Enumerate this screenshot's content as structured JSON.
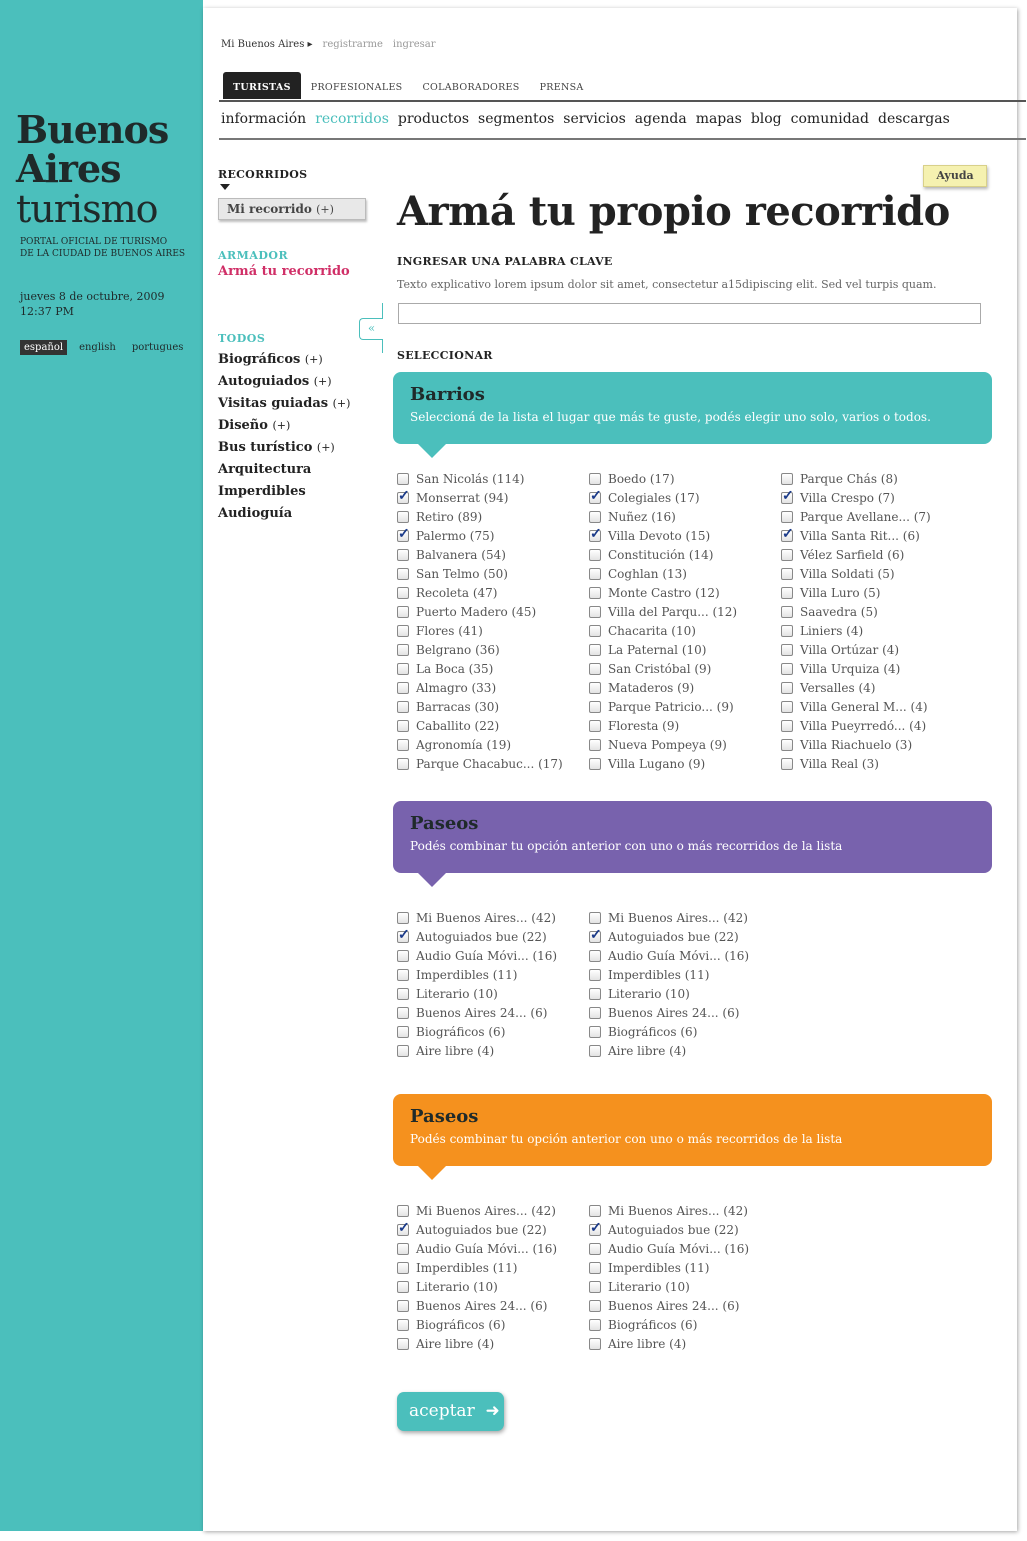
{
  "brand": {
    "line1": "Buenos",
    "line2": "Aires",
    "line3": "turismo",
    "tagline1": "PORTAL OFICIAL DE TURISMO",
    "tagline2": "DE LA CIUDAD DE BUENOS AIRES"
  },
  "datetime": {
    "date": "jueves 8 de octubre, 2009",
    "time": "12:37 PM"
  },
  "languages": [
    "español",
    "english",
    "portugues"
  ],
  "topbar": {
    "account": "Mi Buenos Aires ▸",
    "register": "registrarme",
    "login": "ingresar"
  },
  "tabs": [
    "TURISTAS",
    "PROFESIONALES",
    "COLABORADORES",
    "PRENSA"
  ],
  "nav": [
    "información",
    "recorridos",
    "productos",
    "segmentos",
    "servicios",
    "agenda",
    "mapas",
    "blog",
    "comunidad",
    "descargas"
  ],
  "sidebar": {
    "title": "RECORRIDOS",
    "mi_recorrido": "Mi recorrido",
    "mi_recorrido_plus": "(+)",
    "armador": "ARMADOR",
    "arma_link": "Armá tu recorrido",
    "todos": "TODOS",
    "categories": [
      {
        "label": "Biográficos",
        "plus": "(+)"
      },
      {
        "label": "Autoguiados",
        "plus": "(+)"
      },
      {
        "label": "Visitas guiadas",
        "plus": "(+)"
      },
      {
        "label": "Diseño",
        "plus": "(+)"
      },
      {
        "label": "Bus turístico",
        "plus": "(+)"
      },
      {
        "label": "Arquitectura",
        "plus": ""
      },
      {
        "label": "Imperdibles",
        "plus": ""
      },
      {
        "label": "Audioguía",
        "plus": ""
      }
    ],
    "collapse_glyph": "«"
  },
  "help_label": "Ayuda",
  "page_title": "Armá tu propio recorrido",
  "keyword": {
    "label": "INGRESAR UNA PALABRA CLAVE",
    "help": "Texto explicativo lorem ipsum dolor sit amet, consectetur a15dipiscing elit. Sed vel turpis quam.",
    "value": ""
  },
  "select_label": "SELECCIONAR",
  "barrios": {
    "title": "Barrios",
    "desc": "Seleccioná de la lista el lugar que más te guste, podés elegir uno solo, varios o todos.",
    "columns": [
      [
        {
          "label": "San Nicolás (114)",
          "checked": false
        },
        {
          "label": "Monserrat (94)",
          "checked": true
        },
        {
          "label": "Retiro (89)",
          "checked": false
        },
        {
          "label": "Palermo (75)",
          "checked": true
        },
        {
          "label": "Balvanera (54)",
          "checked": false
        },
        {
          "label": "San Telmo (50)",
          "checked": false
        },
        {
          "label": "Recoleta (47)",
          "checked": false
        },
        {
          "label": "Puerto Madero (45)",
          "checked": false
        },
        {
          "label": "Flores (41)",
          "checked": false
        },
        {
          "label": "Belgrano (36)",
          "checked": false
        },
        {
          "label": "La Boca (35)",
          "checked": false
        },
        {
          "label": "Almagro (33)",
          "checked": false
        },
        {
          "label": "Barracas (30)",
          "checked": false
        },
        {
          "label": "Caballito (22)",
          "checked": false
        },
        {
          "label": "Agronomía (19)",
          "checked": false
        },
        {
          "label": "Parque Chacabuc... (17)",
          "checked": false
        }
      ],
      [
        {
          "label": "Boedo (17)",
          "checked": false
        },
        {
          "label": "Colegiales (17)",
          "checked": true
        },
        {
          "label": "Nuñez (16)",
          "checked": false
        },
        {
          "label": "Villa Devoto (15)",
          "checked": true
        },
        {
          "label": "Constitución (14)",
          "checked": false
        },
        {
          "label": "Coghlan (13)",
          "checked": false
        },
        {
          "label": "Monte Castro (12)",
          "checked": false
        },
        {
          "label": "Villa del Parqu... (12)",
          "checked": false
        },
        {
          "label": "Chacarita (10)",
          "checked": false
        },
        {
          "label": "La Paternal (10)",
          "checked": false
        },
        {
          "label": "San Cristóbal (9)",
          "checked": false
        },
        {
          "label": "Mataderos (9)",
          "checked": false
        },
        {
          "label": "Parque Patricio... (9)",
          "checked": false
        },
        {
          "label": "Floresta (9)",
          "checked": false
        },
        {
          "label": "Nueva Pompeya (9)",
          "checked": false
        },
        {
          "label": "Villa Lugano (9)",
          "checked": false
        }
      ],
      [
        {
          "label": "Parque Chás (8)",
          "checked": false
        },
        {
          "label": "Villa Crespo (7)",
          "checked": true
        },
        {
          "label": "Parque Avellane... (7)",
          "checked": false
        },
        {
          "label": "Villa Santa Rit... (6)",
          "checked": true
        },
        {
          "label": "Vélez Sarfield (6)",
          "checked": false
        },
        {
          "label": "Villa Soldati (5)",
          "checked": false
        },
        {
          "label": "Villa Luro (5)",
          "checked": false
        },
        {
          "label": "Saavedra (5)",
          "checked": false
        },
        {
          "label": "Liniers (4)",
          "checked": false
        },
        {
          "label": "Villa Ortúzar (4)",
          "checked": false
        },
        {
          "label": "Villa Urquiza (4)",
          "checked": false
        },
        {
          "label": "Versalles (4)",
          "checked": false
        },
        {
          "label": "Villa General M... (4)",
          "checked": false
        },
        {
          "label": "Villa Pueyrredó... (4)",
          "checked": false
        },
        {
          "label": "Villa Riachuelo (3)",
          "checked": false
        },
        {
          "label": "Villa Real (3)",
          "checked": false
        }
      ]
    ]
  },
  "paseos1": {
    "title": "Paseos",
    "desc": "Podés combinar tu opción anterior con uno o más  recorridos de la lista",
    "columns": [
      [
        {
          "label": "Mi Buenos Aires... (42)",
          "checked": false
        },
        {
          "label": "Autoguiados bue (22)",
          "checked": true
        },
        {
          "label": "Audio Guía Móvi... (16)",
          "checked": false
        },
        {
          "label": "Imperdibles (11)",
          "checked": false
        },
        {
          "label": "Literario (10)",
          "checked": false
        },
        {
          "label": "Buenos Aires 24... (6)",
          "checked": false
        },
        {
          "label": "Biográficos (6)",
          "checked": false
        },
        {
          "label": "Aire libre (4)",
          "checked": false
        }
      ],
      [
        {
          "label": "Mi Buenos Aires... (42)",
          "checked": false
        },
        {
          "label": "Autoguiados bue (22)",
          "checked": true
        },
        {
          "label": "Audio Guía Móvi... (16)",
          "checked": false
        },
        {
          "label": "Imperdibles (11)",
          "checked": false
        },
        {
          "label": "Literario (10)",
          "checked": false
        },
        {
          "label": "Buenos Aires 24... (6)",
          "checked": false
        },
        {
          "label": "Biográficos (6)",
          "checked": false
        },
        {
          "label": "Aire libre (4)",
          "checked": false
        }
      ]
    ]
  },
  "paseos2": {
    "title": "Paseos",
    "desc": "Podés combinar tu opción anterior con uno o más  recorridos de la lista",
    "columns": [
      [
        {
          "label": "Mi Buenos Aires... (42)",
          "checked": false
        },
        {
          "label": "Autoguiados bue (22)",
          "checked": true
        },
        {
          "label": "Audio Guía Móvi... (16)",
          "checked": false
        },
        {
          "label": "Imperdibles (11)",
          "checked": false
        },
        {
          "label": "Literario (10)",
          "checked": false
        },
        {
          "label": "Buenos Aires 24... (6)",
          "checked": false
        },
        {
          "label": "Biográficos (6)",
          "checked": false
        },
        {
          "label": "Aire libre (4)",
          "checked": false
        }
      ],
      [
        {
          "label": "Mi Buenos Aires... (42)",
          "checked": false
        },
        {
          "label": "Autoguiados bue (22)",
          "checked": true
        },
        {
          "label": "Audio Guía Móvi... (16)",
          "checked": false
        },
        {
          "label": "Imperdibles (11)",
          "checked": false
        },
        {
          "label": "Literario (10)",
          "checked": false
        },
        {
          "label": "Buenos Aires 24... (6)",
          "checked": false
        },
        {
          "label": "Biográficos (6)",
          "checked": false
        },
        {
          "label": "Aire libre (4)",
          "checked": false
        }
      ]
    ]
  },
  "submit_label": "aceptar",
  "submit_icon": "arrow-right-icon",
  "colors": {
    "teal": "#4bbfbc",
    "purple": "#7862ad",
    "orange": "#f5911e",
    "pink": "#d02f67"
  }
}
